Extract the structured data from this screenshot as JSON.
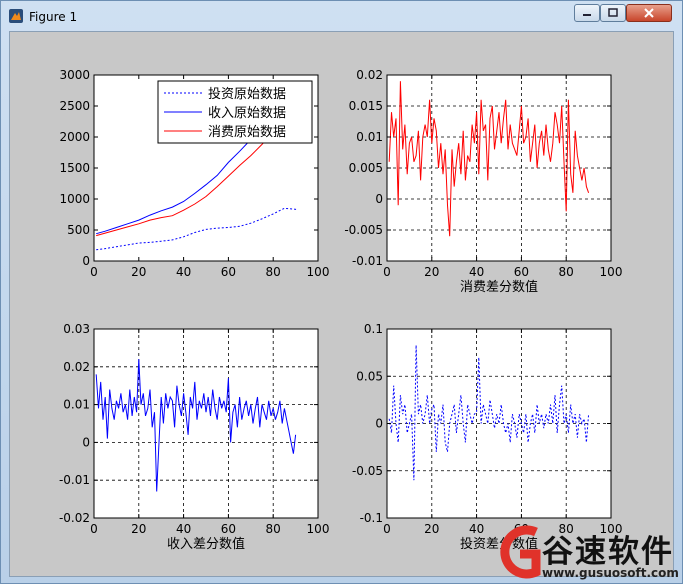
{
  "window": {
    "title": "Figure 1"
  },
  "watermark": {
    "title": "谷速软件",
    "url": "www.gusuosoft.com"
  },
  "chart_data": [
    {
      "type": "line",
      "xlim": [
        0,
        100
      ],
      "ylim": [
        0,
        3000
      ],
      "xticks": [
        "0",
        "20",
        "40",
        "60",
        "80",
        "100"
      ],
      "yticks": [
        "0",
        "500",
        "1000",
        "1500",
        "2000",
        "2500",
        "3000"
      ],
      "grid": false,
      "legend_position": "top-right",
      "xlabel": "",
      "series": [
        {
          "name": "投资原始数据",
          "color": "#0000ff",
          "style": "dotted",
          "x": [
            1,
            5,
            10,
            15,
            20,
            25,
            30,
            35,
            40,
            45,
            50,
            55,
            60,
            65,
            70,
            75,
            80,
            85,
            91
          ],
          "y": [
            180,
            200,
            230,
            260,
            290,
            300,
            320,
            340,
            390,
            460,
            510,
            530,
            540,
            560,
            610,
            680,
            760,
            850,
            830
          ]
        },
        {
          "name": "收入原始数据",
          "color": "#0000ff",
          "style": "solid",
          "x": [
            1,
            5,
            10,
            15,
            20,
            25,
            30,
            35,
            40,
            45,
            50,
            55,
            60,
            65,
            70,
            75,
            78
          ],
          "y": [
            440,
            480,
            540,
            600,
            660,
            740,
            810,
            870,
            960,
            1090,
            1230,
            1380,
            1590,
            1770,
            1960,
            2180,
            2300
          ]
        },
        {
          "name": "消费原始数据",
          "color": "#ff0000",
          "style": "solid",
          "x": [
            1,
            5,
            10,
            15,
            20,
            25,
            30,
            35,
            40,
            45,
            50,
            55,
            60,
            65,
            70,
            75,
            80
          ],
          "y": [
            410,
            450,
            500,
            550,
            600,
            660,
            700,
            730,
            820,
            920,
            1040,
            1200,
            1370,
            1540,
            1700,
            1880,
            2080
          ]
        }
      ]
    },
    {
      "type": "line",
      "xlim": [
        0,
        100
      ],
      "ylim": [
        -0.01,
        0.02
      ],
      "xticks": [
        "0",
        "20",
        "40",
        "60",
        "80",
        "100"
      ],
      "yticks": [
        "-0.01",
        "-0.005",
        "0",
        "0.005",
        "0.01",
        "0.015",
        "0.02"
      ],
      "grid": true,
      "xlabel": "消费差分数值",
      "series": [
        {
          "color": "#ff0000",
          "style": "solid",
          "x": [
            1,
            2,
            3,
            4,
            5,
            6,
            7,
            8,
            9,
            10,
            11,
            12,
            13,
            14,
            15,
            16,
            17,
            18,
            19,
            20,
            21,
            22,
            23,
            24,
            25,
            26,
            27,
            28,
            29,
            30,
            31,
            32,
            33,
            34,
            35,
            36,
            37,
            38,
            39,
            40,
            41,
            42,
            43,
            44,
            45,
            46,
            47,
            48,
            49,
            50,
            51,
            52,
            53,
            54,
            55,
            56,
            57,
            58,
            59,
            60,
            61,
            62,
            63,
            64,
            65,
            66,
            67,
            68,
            69,
            70,
            71,
            72,
            73,
            74,
            75,
            76,
            77,
            78,
            79,
            80,
            81,
            82,
            83,
            84,
            85,
            86,
            87,
            88,
            89,
            90
          ],
          "y": [
            0.006,
            0.014,
            0.01,
            0.013,
            -0.001,
            0.019,
            0.008,
            0.012,
            0.004,
            0.009,
            0.01,
            0.006,
            0.007,
            0.011,
            0.003,
            0.01,
            0.012,
            0.01,
            0.016,
            0.009,
            0.013,
            0.011,
            0.005,
            0.009,
            0.004,
            0.008,
            -0.001,
            -0.006,
            0.008,
            0.002,
            0.006,
            0.009,
            0.004,
            0.011,
            0.003,
            0.007,
            0.006,
            0.012,
            0.009,
            0.014,
            0.004,
            0.016,
            0.011,
            0.012,
            0.003,
            0.013,
            0.015,
            0.008,
            0.011,
            0.014,
            0.009,
            0.013,
            0.016,
            0.008,
            0.012,
            0.009,
            0.008,
            0.007,
            0.011,
            0.015,
            0.009,
            0.01,
            0.013,
            0.006,
            0.009,
            0.012,
            0.005,
            0.009,
            0.011,
            0.007,
            0.012,
            0.008,
            0.006,
            0.009,
            0.014,
            0.012,
            0.009,
            0.015,
            0.006,
            -0.002,
            0.016,
            0.004,
            0.001,
            0.011,
            0.007,
            0.005,
            0.003,
            0.005,
            0.002,
            0.001
          ]
        }
      ]
    },
    {
      "type": "line",
      "xlim": [
        0,
        100
      ],
      "ylim": [
        -0.02,
        0.03
      ],
      "xticks": [
        "0",
        "20",
        "40",
        "60",
        "80",
        "100"
      ],
      "yticks": [
        "-0.02",
        "-0.01",
        "0",
        "0.01",
        "0.02",
        "0.03"
      ],
      "grid": true,
      "xlabel": "收入差分数值",
      "series": [
        {
          "color": "#0000ff",
          "style": "solid",
          "x": [
            1,
            2,
            3,
            4,
            5,
            6,
            7,
            8,
            9,
            10,
            11,
            12,
            13,
            14,
            15,
            16,
            17,
            18,
            19,
            20,
            21,
            22,
            23,
            24,
            25,
            26,
            27,
            28,
            29,
            30,
            31,
            32,
            33,
            34,
            35,
            36,
            37,
            38,
            39,
            40,
            41,
            42,
            43,
            44,
            45,
            46,
            47,
            48,
            49,
            50,
            51,
            52,
            53,
            54,
            55,
            56,
            57,
            58,
            59,
            60,
            61,
            62,
            63,
            64,
            65,
            66,
            67,
            68,
            69,
            70,
            71,
            72,
            73,
            74,
            75,
            76,
            77,
            78,
            79,
            80,
            81,
            82,
            83,
            84,
            85,
            86,
            87,
            88,
            89,
            90
          ],
          "y": [
            0.018,
            0.009,
            0.016,
            0.006,
            0.012,
            0.001,
            0.014,
            0.009,
            0.006,
            0.011,
            0.009,
            0.013,
            0.008,
            0.01,
            0.006,
            0.014,
            0.007,
            0.012,
            0.008,
            0.022,
            0.01,
            0.013,
            0.007,
            0.009,
            0.014,
            0.004,
            0.008,
            -0.013,
            0.0,
            0.012,
            0.005,
            0.013,
            0.009,
            0.012,
            0.011,
            0.004,
            0.015,
            0.01,
            0.007,
            0.013,
            0.008,
            0.002,
            0.012,
            0.009,
            0.016,
            0.006,
            0.011,
            0.009,
            0.013,
            0.008,
            0.012,
            0.007,
            0.014,
            0.009,
            0.006,
            0.012,
            0.009,
            0.011,
            0.008,
            0.017,
            0.0,
            0.008,
            0.01,
            0.004,
            0.012,
            0.006,
            0.009,
            0.011,
            0.007,
            0.01,
            0.005,
            0.009,
            0.012,
            0.004,
            0.01,
            0.008,
            0.006,
            0.011,
            0.007,
            0.009,
            0.006,
            0.008,
            0.011,
            0.005,
            0.009,
            0.006,
            0.003,
            0.0,
            -0.003,
            0.002
          ]
        }
      ]
    },
    {
      "type": "line",
      "xlim": [
        0,
        100
      ],
      "ylim": [
        -0.1,
        0.1
      ],
      "xticks": [
        "0",
        "20",
        "40",
        "60",
        "80",
        "100"
      ],
      "yticks": [
        "-0.1",
        "-0.05",
        "0",
        "0.05",
        "0.1"
      ],
      "grid": true,
      "xlabel": "投资差分数值",
      "series": [
        {
          "color": "#0000ff",
          "style": "dotted",
          "x": [
            1,
            2,
            3,
            4,
            5,
            6,
            7,
            8,
            9,
            10,
            11,
            12,
            13,
            14,
            15,
            16,
            17,
            18,
            19,
            20,
            21,
            22,
            23,
            24,
            25,
            26,
            27,
            28,
            29,
            30,
            31,
            32,
            33,
            34,
            35,
            36,
            37,
            38,
            39,
            40,
            41,
            42,
            43,
            44,
            45,
            46,
            47,
            48,
            49,
            50,
            51,
            52,
            53,
            54,
            55,
            56,
            57,
            58,
            59,
            60,
            61,
            62,
            63,
            64,
            65,
            66,
            67,
            68,
            69,
            70,
            71,
            72,
            73,
            74,
            75,
            76,
            77,
            78,
            79,
            80,
            81,
            82,
            83,
            84,
            85,
            86,
            87,
            88,
            89,
            90
          ],
          "y": [
            0.005,
            -0.01,
            0.04,
            0.0,
            -0.02,
            0.03,
            0.01,
            0.02,
            -0.01,
            0.0,
            0.01,
            -0.06,
            0.083,
            0.01,
            0.02,
            0.0,
            0.01,
            0.03,
            0.0,
            0.015,
            0.02,
            -0.03,
            0.01,
            0.0,
            0.02,
            -0.02,
            -0.03,
            0.0,
            0.01,
            0.02,
            -0.01,
            0.01,
            0.03,
            0.0,
            -0.02,
            0.02,
            0.01,
            0.0,
            0.01,
            0.012,
            0.07,
            0.0,
            0.02,
            0.01,
            0.0,
            0.025,
            0.01,
            -0.005,
            0.01,
            0.0,
            0.02,
            0.0,
            -0.01,
            0.0,
            -0.02,
            0.01,
            0.0,
            -0.015,
            0.01,
            0.0,
            -0.01,
            0.01,
            -0.02,
            0.0,
            0.01,
            -0.01,
            0.02,
            0.0,
            0.01,
            -0.005,
            0.01,
            0.0,
            0.02,
            0.0,
            0.03,
            -0.01,
            0.02,
            0.04,
            0.0,
            0.01,
            -0.01,
            0.02,
            0.0,
            0.01,
            -0.015,
            0.01,
            0.0,
            0.005,
            -0.02,
            0.01
          ]
        }
      ]
    }
  ]
}
